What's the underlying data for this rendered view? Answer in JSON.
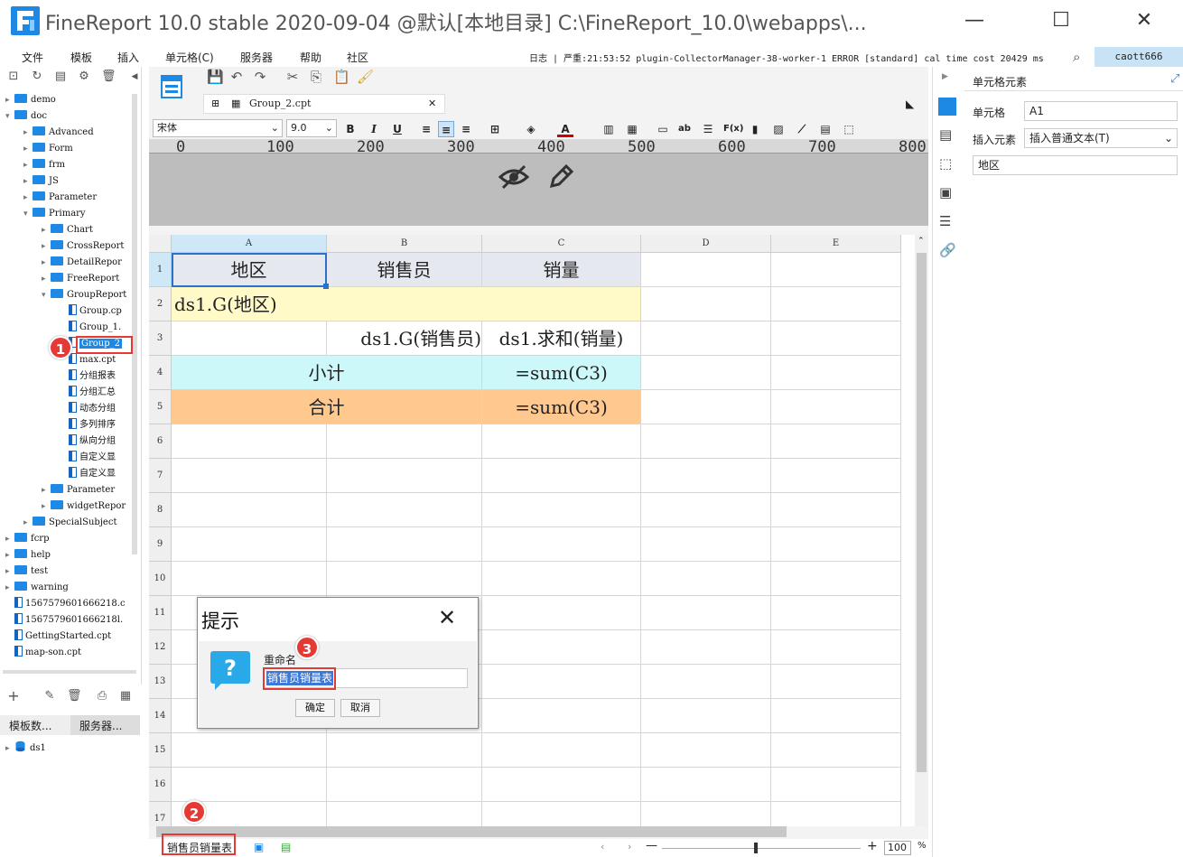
{
  "window": {
    "title": "FineReport 10.0 stable 2020-09-04 @默认[本地目录]    C:\\FineReport_10.0\\webapps\\..."
  },
  "menu": {
    "items": [
      "文件",
      "模板",
      "插入",
      "单元格(C)",
      "服务器",
      "帮助",
      "社区"
    ],
    "log": "日志 | 严重:21:53:52 plugin-CollectorManager-38-worker-1 ERROR [standard] cal time cost 20429 ms",
    "user": "caott666"
  },
  "tree": {
    "items": [
      "demo",
      "doc",
      "Advanced",
      "Form",
      "frm",
      "JS",
      "Parameter",
      "Primary",
      "Chart",
      "CrossReport",
      "DetailRepor",
      "FreeReport",
      "GroupReport",
      "Group.cp",
      "Group_1.",
      "Group_2",
      "max.cpt",
      "分组报表",
      "分组汇总",
      "动态分组",
      "多列排序",
      "纵向分组",
      "自定义显",
      "自定义显",
      "Parameter",
      "widgetRepor",
      "SpecialSubject",
      "fcrp",
      "help",
      "test",
      "warning",
      "1567579601666218.c",
      "1567579601666218l.",
      "GettingStarted.cpt",
      "map-son.cpt"
    ]
  },
  "bottom_tabs": {
    "templates": "模板数...",
    "server": "服务器..."
  },
  "dataset": {
    "name": "ds1"
  },
  "doc_tab": {
    "name": "Group_2.cpt"
  },
  "format": {
    "font": "宋体",
    "size": "9.0"
  },
  "ruler": {
    "labels": [
      "0",
      "100",
      "200",
      "300",
      "400",
      "500",
      "600",
      "700",
      "800"
    ]
  },
  "grid": {
    "columns": [
      "A",
      "B",
      "C",
      "D",
      "E"
    ],
    "rows": [
      "1",
      "2",
      "3",
      "4",
      "5",
      "6",
      "7",
      "8",
      "9",
      "10",
      "11",
      "12",
      "13",
      "14",
      "15",
      "16",
      "17"
    ],
    "cells": {
      "a1": "地区",
      "b1": "销售员",
      "c1": "销量",
      "a2": "ds1.G(地区)",
      "b3": "ds1.G(销售员)",
      "c3": "ds1.求和(销量)",
      "ab4": "小计",
      "c4": "=sum(C3)",
      "ab5": "合计",
      "c5": "=sum(C3)"
    },
    "colors": {
      "header": "#e6e8f0",
      "group": "#fffac8",
      "subtotal": "#ccf8fa",
      "total": "#ffc88f"
    }
  },
  "sheet_tab": {
    "name": "销售员销量表"
  },
  "zoom": {
    "value": "100",
    "unit": "%"
  },
  "right_panel": {
    "title": "单元格元素",
    "cell_label": "单元格",
    "cell_value": "A1",
    "insert_label": "插入元素",
    "insert_value": "插入普通文本(T)",
    "content": "地区"
  },
  "dialog": {
    "title": "提示",
    "label": "重命名",
    "value": "销售员销量表",
    "ok": "确定",
    "cancel": "取消"
  },
  "badges": {
    "b1": "1",
    "b2": "2",
    "b3": "3"
  }
}
